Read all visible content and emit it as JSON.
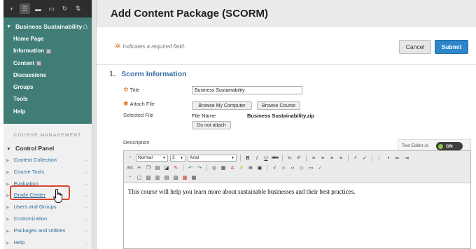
{
  "sidebar": {
    "toolbar_icons": [
      "plus-icon",
      "list-icon",
      "folder-icon",
      "panel-icon",
      "refresh-icon",
      "sort-icon"
    ],
    "course": {
      "title": "Business Sustainability",
      "items": [
        {
          "label": "Home Page"
        },
        {
          "label": "Information"
        },
        {
          "label": "Content"
        },
        {
          "label": "Discussions"
        },
        {
          "label": "Groups"
        },
        {
          "label": "Tools"
        },
        {
          "label": "Help"
        }
      ]
    },
    "course_management_label": "COURSE MANAGEMENT",
    "control_panel": {
      "title": "Control Panel",
      "items": [
        {
          "label": "Content Collection"
        },
        {
          "label": "Course Tools"
        },
        {
          "label": "Evaluation"
        },
        {
          "label": "Grade Center"
        },
        {
          "label": "Users and Groups"
        },
        {
          "label": "Customization"
        },
        {
          "label": "Packages and Utilities"
        },
        {
          "label": "Help"
        }
      ]
    }
  },
  "main": {
    "title": "Add Content Package (SCORM)",
    "required_note": "Indicates a required field.",
    "cancel_label": "Cancel",
    "submit_label": "Submit",
    "section": {
      "number": "1.",
      "title": "Scorm Information"
    },
    "fields": {
      "title_label": "Title",
      "title_value": "Business Sustainability",
      "attach_label": "Attach File",
      "browse_computer": "Browse My Computer",
      "browse_course": "Browse Course",
      "selected_label": "Selected File",
      "file_name_label": "File Name",
      "file_name_value": "Business Sustainability.zip",
      "do_not_attach": "Do not attach",
      "description_label": "Description"
    },
    "editor": {
      "text_editor_label": "Text Editor is:",
      "toggle_value": "ON",
      "format_value": "Normal",
      "size_value": "3",
      "font_value": "Arial",
      "content": "This course will help you learn more about sustainable businesses and their best practices."
    }
  },
  "colors": {
    "course_teal": "#3f7d76",
    "link_blue": "#2a6f9c",
    "submit_blue": "#2c86c9",
    "highlight_red": "#d94630",
    "required_orange": "#e07b2a"
  }
}
